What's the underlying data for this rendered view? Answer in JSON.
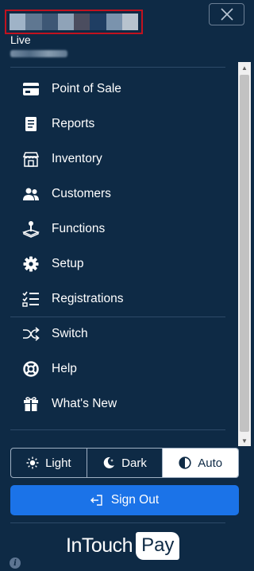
{
  "header": {
    "status": "Live"
  },
  "nav": {
    "items": [
      {
        "label": "Point of Sale",
        "icon": "credit-card-icon"
      },
      {
        "label": "Reports",
        "icon": "report-document-icon"
      },
      {
        "label": "Inventory",
        "icon": "store-icon"
      },
      {
        "label": "Customers",
        "icon": "users-icon"
      },
      {
        "label": "Functions",
        "icon": "joystick-icon"
      },
      {
        "label": "Setup",
        "icon": "gear-icon"
      },
      {
        "label": "Registrations",
        "icon": "checklist-icon"
      },
      {
        "label": "Switch",
        "icon": "shuffle-icon"
      },
      {
        "label": "Help",
        "icon": "lifebuoy-icon"
      },
      {
        "label": "What's New",
        "icon": "gift-icon"
      }
    ]
  },
  "theme": {
    "options": [
      "Light",
      "Dark",
      "Auto"
    ],
    "selected": "Auto"
  },
  "signout": {
    "label": "Sign Out"
  },
  "logo": {
    "brand": "InTouch",
    "pay": "Pay"
  },
  "colors": {
    "background": "#0e2a45",
    "accent": "#1b73e8",
    "redaction_border": "#c1121f"
  }
}
